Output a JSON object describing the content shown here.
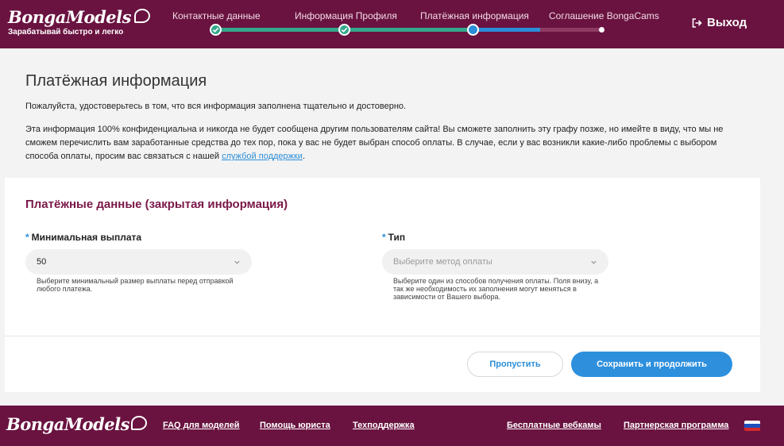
{
  "header": {
    "logo": "BongaModels",
    "slogan": "Зарабатывай быстро и легко",
    "steps": [
      {
        "label": "Контактные данные",
        "state": "done"
      },
      {
        "label": "Информация Профиля",
        "state": "done"
      },
      {
        "label": "Платёжная информация",
        "state": "current"
      },
      {
        "label": "Соглашение BongaCams",
        "state": "todo"
      }
    ],
    "logout_label": "Выход"
  },
  "intro": {
    "title": "Платёжная информация",
    "paragraph1": "Пожалуйста, удостоверьтесь в том, что вся информация заполнена тщательно и достоверно.",
    "paragraph2": "Эта информация 100% конфиденциальна и никогда не будет сообщена другим пользователям сайта! Вы сможете заполнить эту графу позже, но имейте в виду, что мы не сможем перечислить вам заработанные средства до тех пор, пока у вас не будет выбран способ оплаты. В случае, если у вас возникли какие-либо проблемы с выбором способа оплаты, просим вас связаться с нашей",
    "support_link": "службой поддержки",
    "paragraph2_end": "."
  },
  "form": {
    "title": "Платёжные данные (закрытая информация)",
    "required_mark": "*",
    "min_payout": {
      "label": "Минимальная выплата",
      "value": "50",
      "hint": "Выберите минимальный размер выплаты перед отправкой любого платежа."
    },
    "type": {
      "label": "Тип",
      "placeholder": "Выберите метод оплаты",
      "hint": "Выберите один из способов получения оплаты. Поля внизу, а так же необходимость их заполнения могут меняться в зависимости от Вашего выбора."
    },
    "skip_button": "Пропустить",
    "save_button": "Сохранить и продолжить"
  },
  "footer": {
    "logo": "BongaModels",
    "links": [
      "FAQ для моделей",
      "Помощь юриста",
      "Техподдержка",
      "Бесплатные вебкамы",
      "Партнерская программа"
    ],
    "language_flag": "ru-flag-icon"
  },
  "colors": {
    "brand": "#6a1340",
    "accent_blue": "#2e90dd",
    "done_green": "#34a88c",
    "title_maroon": "#7a1848"
  }
}
